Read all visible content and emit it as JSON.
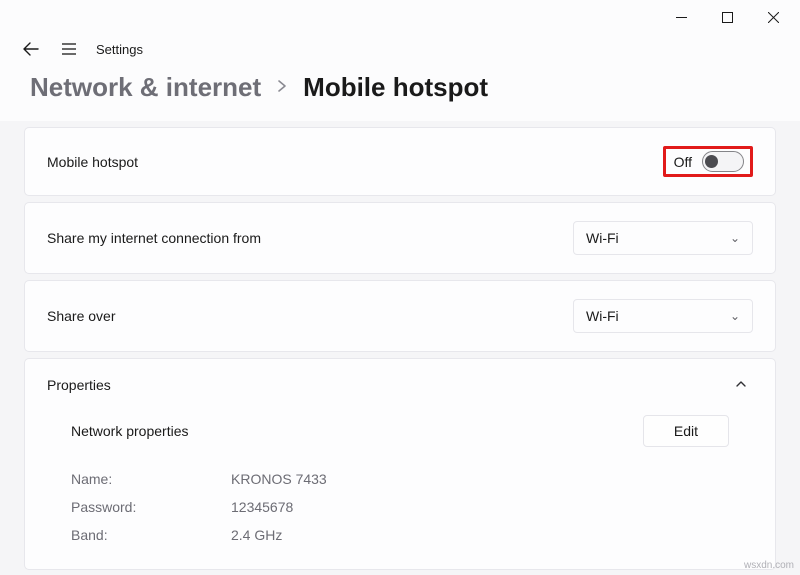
{
  "window": {
    "app_title": "Settings",
    "breadcrumb_parent": "Network & internet",
    "breadcrumb_current": "Mobile hotspot"
  },
  "hotspot": {
    "label": "Mobile hotspot",
    "state_text": "Off"
  },
  "share_from": {
    "label": "Share my internet connection from",
    "value": "Wi-Fi"
  },
  "share_over": {
    "label": "Share over",
    "value": "Wi-Fi"
  },
  "properties": {
    "section_label": "Properties",
    "header": "Network properties",
    "edit_label": "Edit",
    "name_label": "Name:",
    "name_value": "KRONOS 7433",
    "password_label": "Password:",
    "password_value": "12345678",
    "band_label": "Band:",
    "band_value": "2.4 GHz"
  },
  "watermark": "wsxdn.com"
}
